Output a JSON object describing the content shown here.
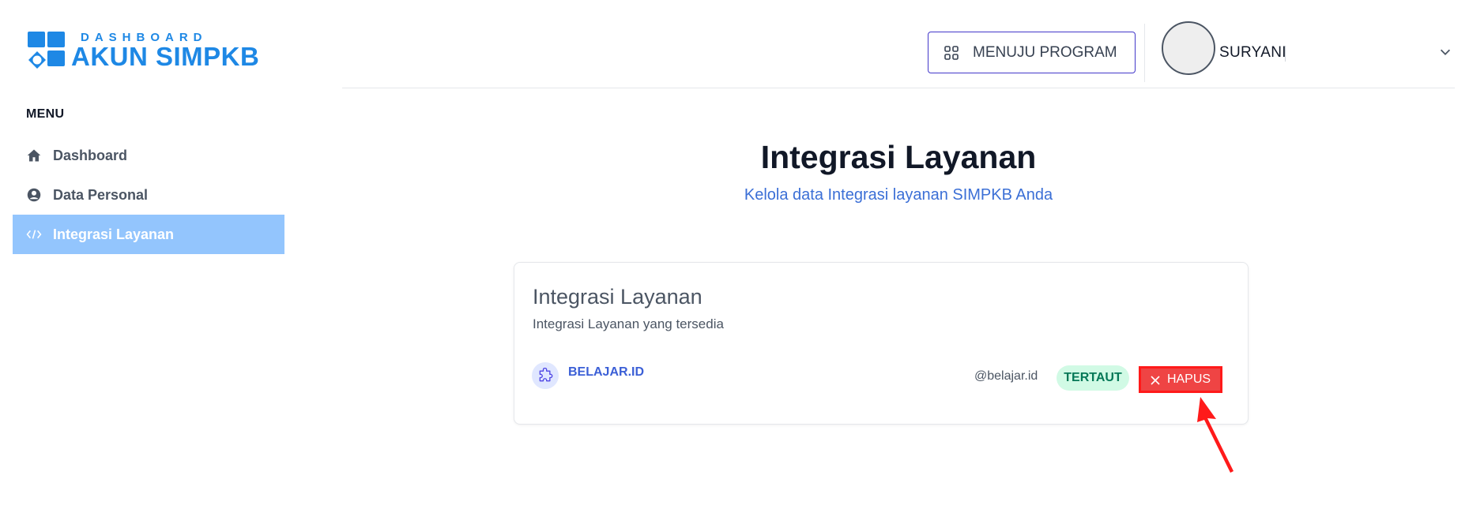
{
  "sidebar": {
    "logo": {
      "small": "DASHBOARD",
      "big": "AKUN SIMPKB"
    },
    "menu_heading": "MENU",
    "items": [
      {
        "label": "Dashboard",
        "icon": "home-icon",
        "active": false
      },
      {
        "label": "Data Personal",
        "icon": "user-circle-icon",
        "active": false
      },
      {
        "label": "Integrasi Layanan",
        "icon": "code-icon",
        "active": true
      }
    ]
  },
  "header": {
    "program_button": "MENUJU PROGRAM",
    "user_name": "SURYANI"
  },
  "main": {
    "title": "Integrasi Layanan",
    "subtitle": "Kelola data Integrasi layanan SIMPKB Anda",
    "card": {
      "title": "Integrasi Layanan",
      "subtitle": "Integrasi Layanan yang tersedia",
      "service": {
        "name": "BELAJAR.ID",
        "handle": "@belajar.id",
        "status": "TERTAUT",
        "remove_label": "HAPUS",
        "icon": "puzzle-icon"
      }
    }
  },
  "colors": {
    "brand": "#1e88e5",
    "active_nav": "#93c5fd",
    "link": "#3b6fd6",
    "status_bg": "#d1fae5",
    "status_text": "#047857",
    "danger": "#ef4444",
    "annotation": "#ff1a1a"
  }
}
